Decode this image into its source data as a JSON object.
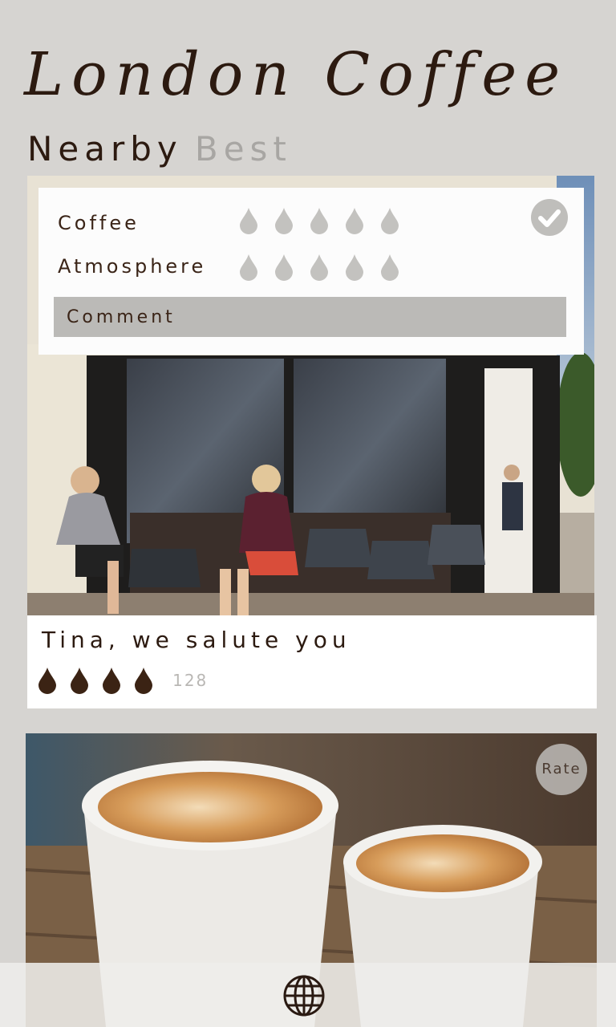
{
  "app": {
    "title": "London Coffee"
  },
  "tabs": [
    {
      "label": "Nearby",
      "active": true
    },
    {
      "label": "Best",
      "active": false
    }
  ],
  "rating_panel": {
    "coffee_label": "Coffee",
    "atmosphere_label": "Atmosphere",
    "coffee_drops": 5,
    "atmosphere_drops": 5,
    "comment_placeholder": "Comment",
    "confirm_icon": "checkmark-icon"
  },
  "cafe_card": {
    "name": "Tina, we salute you",
    "rating_drops": 4,
    "rating_count": "128"
  },
  "second_card": {
    "rate_label": "Rate"
  },
  "bottom_bar": {
    "icon": "globe-icon"
  },
  "colors": {
    "background": "#d6d4d1",
    "title": "#2c1a10",
    "drop_dark": "#3b2314",
    "drop_light": "#c3c2bf",
    "comment_bg": "#bbbab7"
  }
}
